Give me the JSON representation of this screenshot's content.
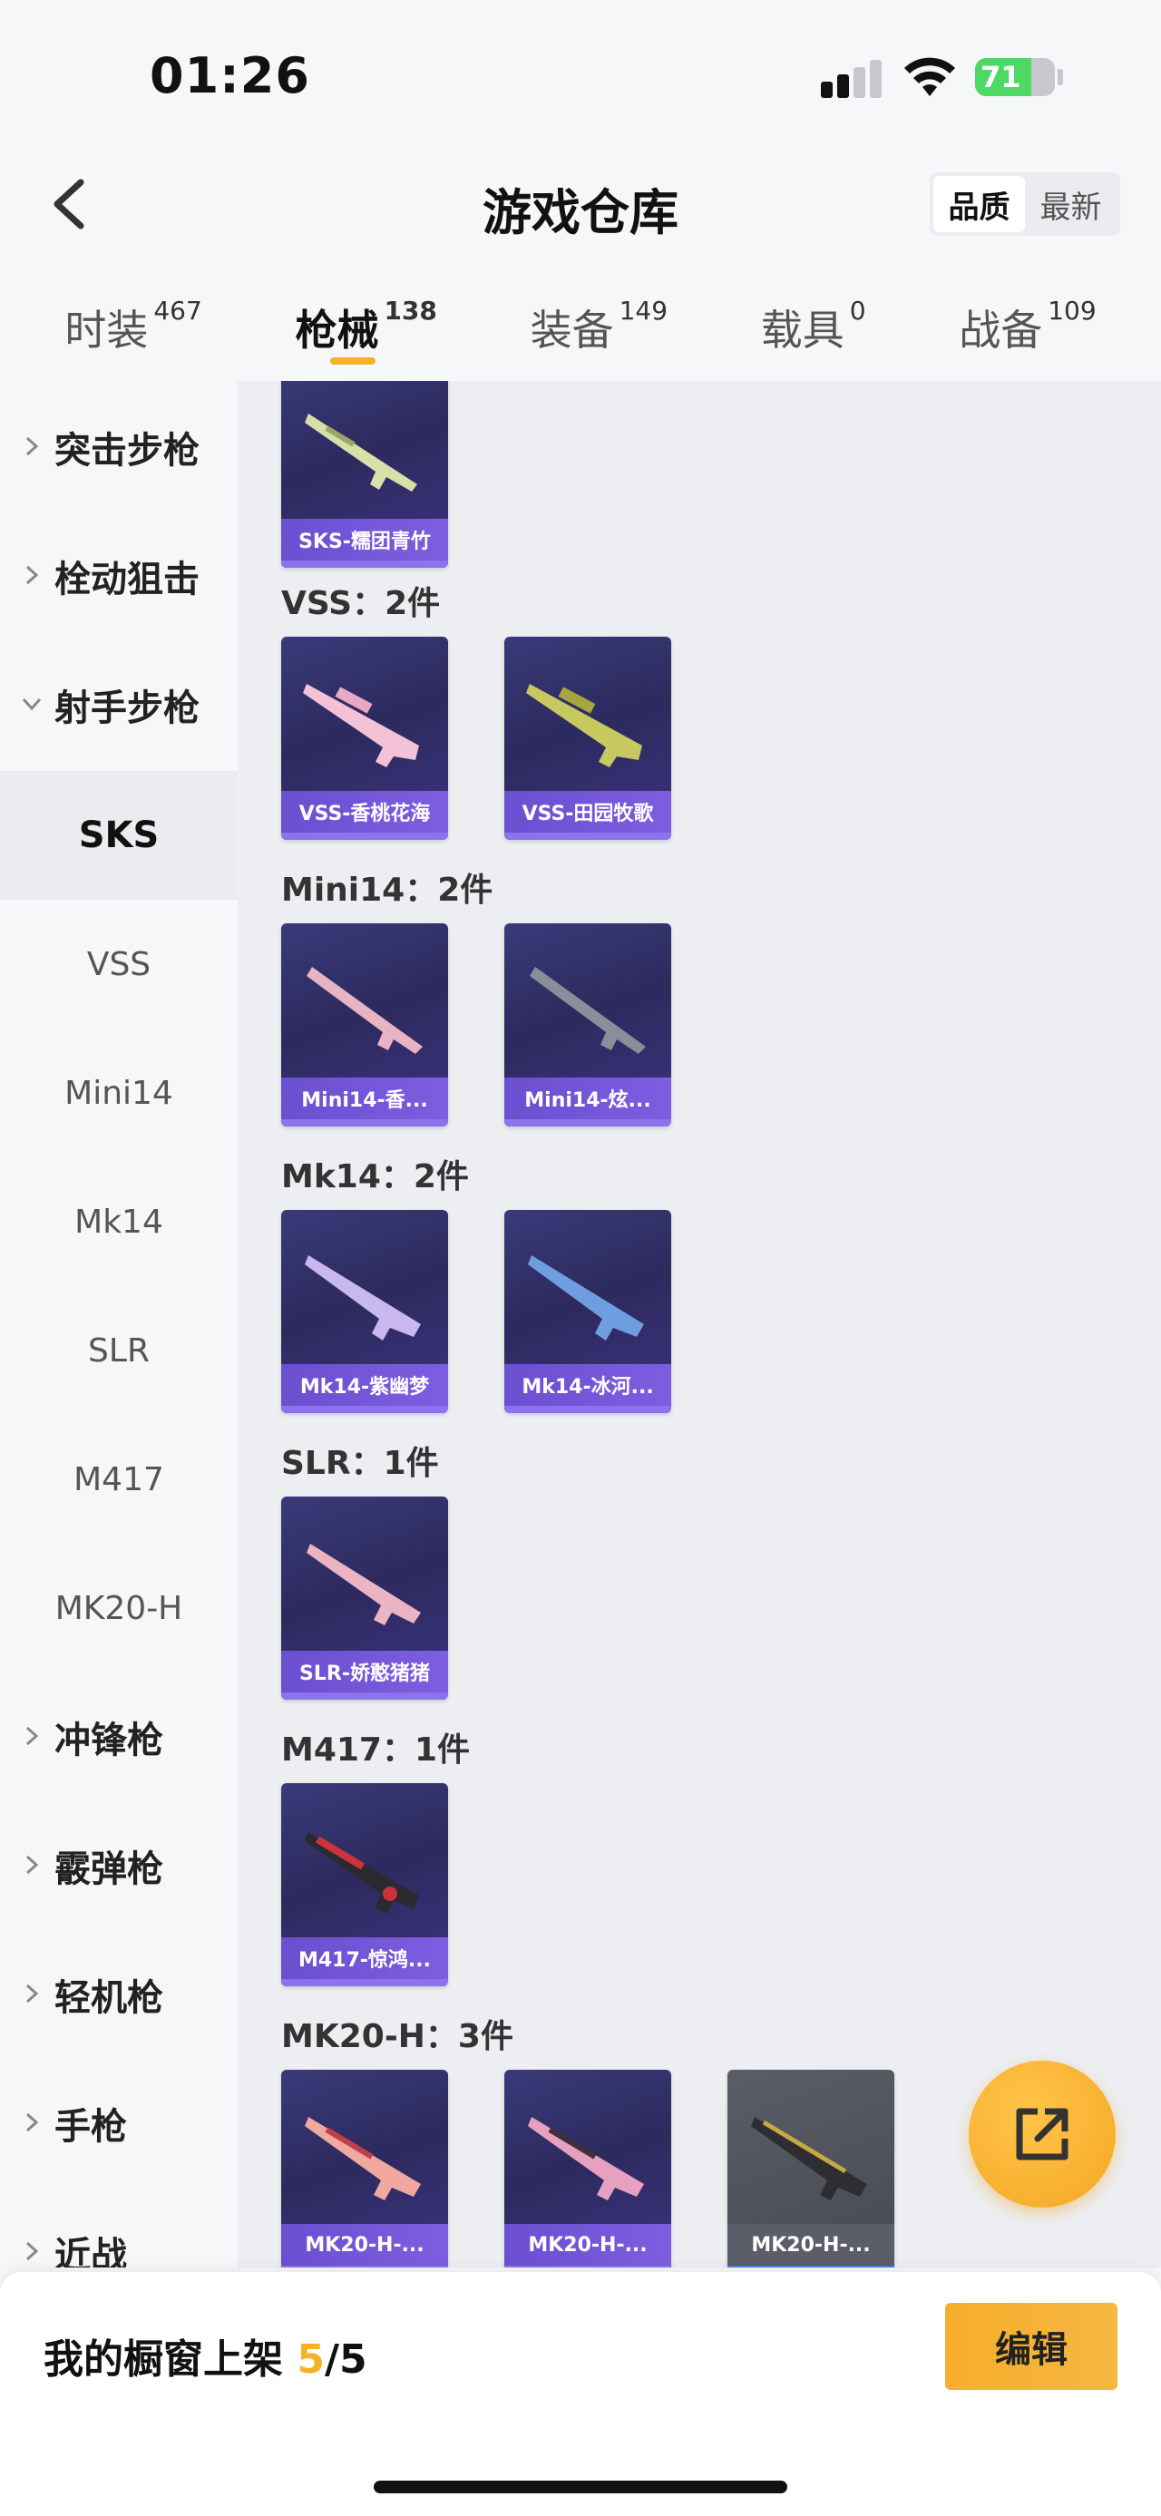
{
  "status": {
    "time": "01:26",
    "battery": "71"
  },
  "header": {
    "title": "游戏仓库",
    "sort_options": [
      "品质",
      "最新"
    ],
    "active_sort": "品质"
  },
  "tabs": [
    {
      "label": "时装",
      "count": "467"
    },
    {
      "label": "枪械",
      "count": "138"
    },
    {
      "label": "装备",
      "count": "149"
    },
    {
      "label": "载具",
      "count": "0"
    },
    {
      "label": "战备",
      "count": "109"
    }
  ],
  "sidebar": {
    "categories": [
      "突击步枪",
      "栓动狙击",
      "射手步枪"
    ],
    "subitems": [
      "SKS",
      "VSS",
      "Mini14",
      "Mk14",
      "SLR",
      "M417",
      "MK20-H"
    ],
    "more_categories": [
      "冲锋枪",
      "霰弹枪",
      "轻机枪",
      "手枪",
      "近战"
    ]
  },
  "sections": [
    {
      "title": "",
      "items": [
        "SKS-糯团青竹"
      ]
    },
    {
      "title": "VSS：2件",
      "items": [
        "VSS-香桃花海",
        "VSS-田园牧歌"
      ]
    },
    {
      "title": "Mini14：2件",
      "items": [
        "Mini14-香...",
        "Mini14-炫..."
      ]
    },
    {
      "title": "Mk14：2件",
      "items": [
        "Mk14-紫幽梦",
        "Mk14-冰河..."
      ]
    },
    {
      "title": "SLR：1件",
      "items": [
        "SLR-娇憨猪猪"
      ]
    },
    {
      "title": "M417：1件",
      "items": [
        "M417-惊鸿..."
      ]
    },
    {
      "title": "MK20-H：3件",
      "items": [
        "MK20-H-...",
        "MK20-H-...",
        "MK20-H-..."
      ]
    }
  ],
  "bottom": {
    "shelf_label": "我的橱窗上架",
    "shelf_count": "5",
    "shelf_total": "/5",
    "edit_label": "编辑"
  },
  "colors": {
    "accent": "#f5b223",
    "card_purple": "#3b3380",
    "label_purple": "#7e5ee0"
  }
}
